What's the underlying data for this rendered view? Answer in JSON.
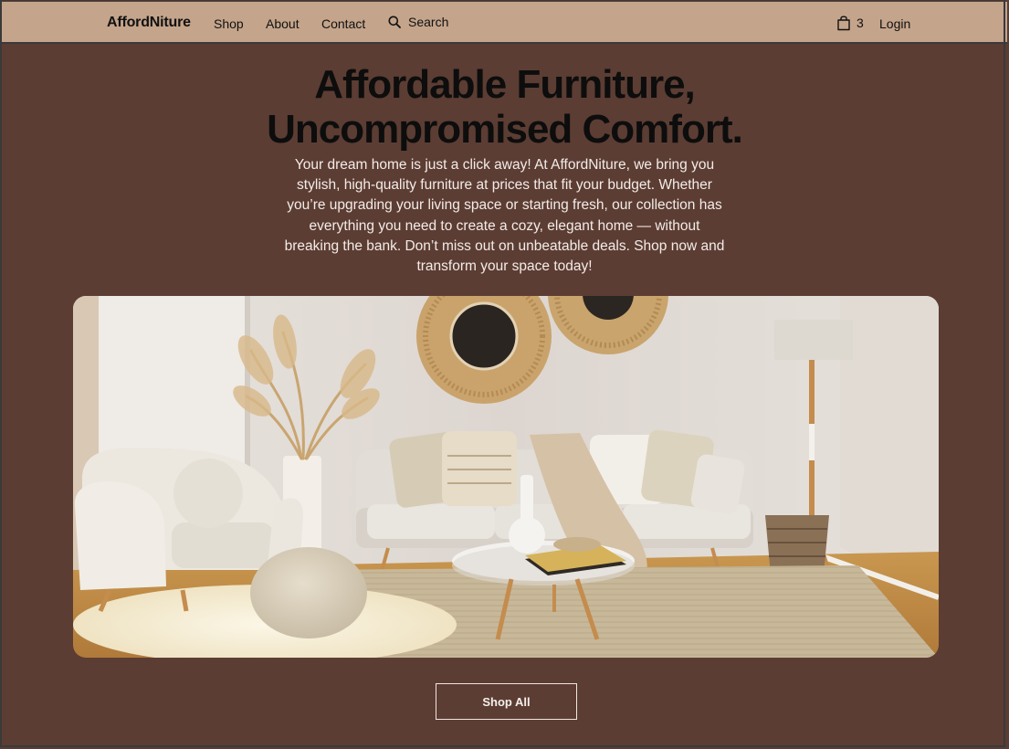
{
  "nav": {
    "brand": "AffordNiture",
    "links": [
      "Shop",
      "About",
      "Contact"
    ],
    "search_label": "Search",
    "cart_count": "3",
    "login_label": "Login"
  },
  "hero": {
    "title_line1": "Affordable Furniture,",
    "title_line2": "Uncompromised Comfort.",
    "description": "Your dream home is just a click away! At AffordNiture, we bring you stylish, high-quality furniture at prices that fit your budget. Whether you’re upgrading your living space or starting fresh, our collection has everything you need to create a cozy, elegant home — without breaking the bank. Don’t miss out on unbeatable deals. Shop now and transform your space today!",
    "image_icon": "living-room-photo",
    "cta_label": "Shop All"
  },
  "colors": {
    "page_bg": "#5c3d33",
    "nav_bg": "#c4a48b",
    "title_text": "#0d0d0d",
    "body_text": "#f3ece8"
  }
}
